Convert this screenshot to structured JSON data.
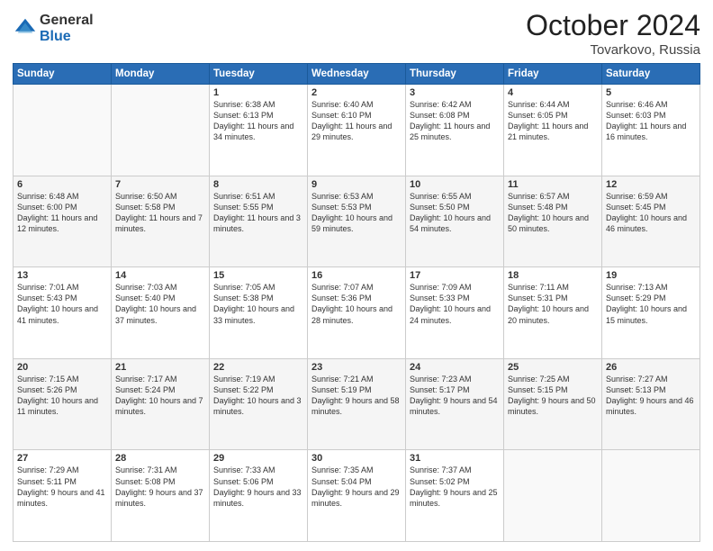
{
  "header": {
    "logo_general": "General",
    "logo_blue": "Blue",
    "month_title": "October 2024",
    "location": "Tovarkovo, Russia"
  },
  "days_of_week": [
    "Sunday",
    "Monday",
    "Tuesday",
    "Wednesday",
    "Thursday",
    "Friday",
    "Saturday"
  ],
  "weeks": [
    [
      {
        "day": "",
        "info": ""
      },
      {
        "day": "",
        "info": ""
      },
      {
        "day": "1",
        "sunrise": "Sunrise: 6:38 AM",
        "sunset": "Sunset: 6:13 PM",
        "daylight": "Daylight: 11 hours and 34 minutes."
      },
      {
        "day": "2",
        "sunrise": "Sunrise: 6:40 AM",
        "sunset": "Sunset: 6:10 PM",
        "daylight": "Daylight: 11 hours and 29 minutes."
      },
      {
        "day": "3",
        "sunrise": "Sunrise: 6:42 AM",
        "sunset": "Sunset: 6:08 PM",
        "daylight": "Daylight: 11 hours and 25 minutes."
      },
      {
        "day": "4",
        "sunrise": "Sunrise: 6:44 AM",
        "sunset": "Sunset: 6:05 PM",
        "daylight": "Daylight: 11 hours and 21 minutes."
      },
      {
        "day": "5",
        "sunrise": "Sunrise: 6:46 AM",
        "sunset": "Sunset: 6:03 PM",
        "daylight": "Daylight: 11 hours and 16 minutes."
      }
    ],
    [
      {
        "day": "6",
        "sunrise": "Sunrise: 6:48 AM",
        "sunset": "Sunset: 6:00 PM",
        "daylight": "Daylight: 11 hours and 12 minutes."
      },
      {
        "day": "7",
        "sunrise": "Sunrise: 6:50 AM",
        "sunset": "Sunset: 5:58 PM",
        "daylight": "Daylight: 11 hours and 7 minutes."
      },
      {
        "day": "8",
        "sunrise": "Sunrise: 6:51 AM",
        "sunset": "Sunset: 5:55 PM",
        "daylight": "Daylight: 11 hours and 3 minutes."
      },
      {
        "day": "9",
        "sunrise": "Sunrise: 6:53 AM",
        "sunset": "Sunset: 5:53 PM",
        "daylight": "Daylight: 10 hours and 59 minutes."
      },
      {
        "day": "10",
        "sunrise": "Sunrise: 6:55 AM",
        "sunset": "Sunset: 5:50 PM",
        "daylight": "Daylight: 10 hours and 54 minutes."
      },
      {
        "day": "11",
        "sunrise": "Sunrise: 6:57 AM",
        "sunset": "Sunset: 5:48 PM",
        "daylight": "Daylight: 10 hours and 50 minutes."
      },
      {
        "day": "12",
        "sunrise": "Sunrise: 6:59 AM",
        "sunset": "Sunset: 5:45 PM",
        "daylight": "Daylight: 10 hours and 46 minutes."
      }
    ],
    [
      {
        "day": "13",
        "sunrise": "Sunrise: 7:01 AM",
        "sunset": "Sunset: 5:43 PM",
        "daylight": "Daylight: 10 hours and 41 minutes."
      },
      {
        "day": "14",
        "sunrise": "Sunrise: 7:03 AM",
        "sunset": "Sunset: 5:40 PM",
        "daylight": "Daylight: 10 hours and 37 minutes."
      },
      {
        "day": "15",
        "sunrise": "Sunrise: 7:05 AM",
        "sunset": "Sunset: 5:38 PM",
        "daylight": "Daylight: 10 hours and 33 minutes."
      },
      {
        "day": "16",
        "sunrise": "Sunrise: 7:07 AM",
        "sunset": "Sunset: 5:36 PM",
        "daylight": "Daylight: 10 hours and 28 minutes."
      },
      {
        "day": "17",
        "sunrise": "Sunrise: 7:09 AM",
        "sunset": "Sunset: 5:33 PM",
        "daylight": "Daylight: 10 hours and 24 minutes."
      },
      {
        "day": "18",
        "sunrise": "Sunrise: 7:11 AM",
        "sunset": "Sunset: 5:31 PM",
        "daylight": "Daylight: 10 hours and 20 minutes."
      },
      {
        "day": "19",
        "sunrise": "Sunrise: 7:13 AM",
        "sunset": "Sunset: 5:29 PM",
        "daylight": "Daylight: 10 hours and 15 minutes."
      }
    ],
    [
      {
        "day": "20",
        "sunrise": "Sunrise: 7:15 AM",
        "sunset": "Sunset: 5:26 PM",
        "daylight": "Daylight: 10 hours and 11 minutes."
      },
      {
        "day": "21",
        "sunrise": "Sunrise: 7:17 AM",
        "sunset": "Sunset: 5:24 PM",
        "daylight": "Daylight: 10 hours and 7 minutes."
      },
      {
        "day": "22",
        "sunrise": "Sunrise: 7:19 AM",
        "sunset": "Sunset: 5:22 PM",
        "daylight": "Daylight: 10 hours and 3 minutes."
      },
      {
        "day": "23",
        "sunrise": "Sunrise: 7:21 AM",
        "sunset": "Sunset: 5:19 PM",
        "daylight": "Daylight: 9 hours and 58 minutes."
      },
      {
        "day": "24",
        "sunrise": "Sunrise: 7:23 AM",
        "sunset": "Sunset: 5:17 PM",
        "daylight": "Daylight: 9 hours and 54 minutes."
      },
      {
        "day": "25",
        "sunrise": "Sunrise: 7:25 AM",
        "sunset": "Sunset: 5:15 PM",
        "daylight": "Daylight: 9 hours and 50 minutes."
      },
      {
        "day": "26",
        "sunrise": "Sunrise: 7:27 AM",
        "sunset": "Sunset: 5:13 PM",
        "daylight": "Daylight: 9 hours and 46 minutes."
      }
    ],
    [
      {
        "day": "27",
        "sunrise": "Sunrise: 7:29 AM",
        "sunset": "Sunset: 5:11 PM",
        "daylight": "Daylight: 9 hours and 41 minutes."
      },
      {
        "day": "28",
        "sunrise": "Sunrise: 7:31 AM",
        "sunset": "Sunset: 5:08 PM",
        "daylight": "Daylight: 9 hours and 37 minutes."
      },
      {
        "day": "29",
        "sunrise": "Sunrise: 7:33 AM",
        "sunset": "Sunset: 5:06 PM",
        "daylight": "Daylight: 9 hours and 33 minutes."
      },
      {
        "day": "30",
        "sunrise": "Sunrise: 7:35 AM",
        "sunset": "Sunset: 5:04 PM",
        "daylight": "Daylight: 9 hours and 29 minutes."
      },
      {
        "day": "31",
        "sunrise": "Sunrise: 7:37 AM",
        "sunset": "Sunset: 5:02 PM",
        "daylight": "Daylight: 9 hours and 25 minutes."
      },
      {
        "day": "",
        "info": ""
      },
      {
        "day": "",
        "info": ""
      }
    ]
  ]
}
